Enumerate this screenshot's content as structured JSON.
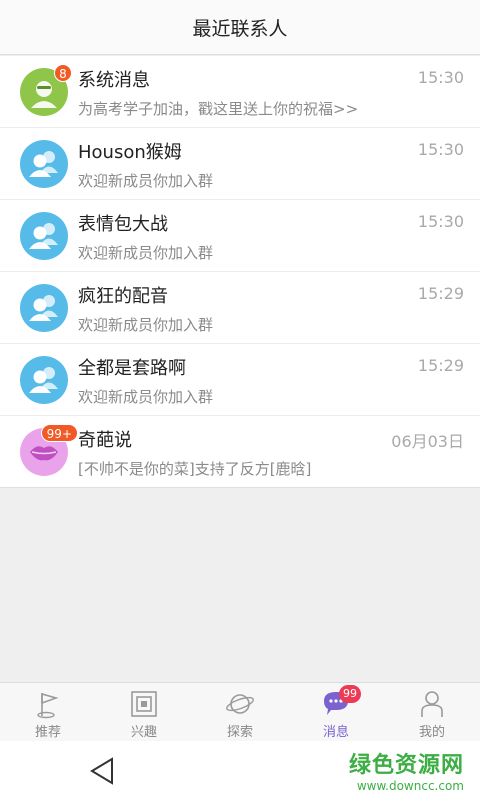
{
  "header": {
    "title": "最近联系人"
  },
  "contacts": [
    {
      "name": "系统消息",
      "time": "15:30",
      "preview": "为高考学子加油，戳这里送上你的祝福>>",
      "badge": "8",
      "avatar": "system"
    },
    {
      "name": "Houson猴姆",
      "time": "15:30",
      "preview": "欢迎新成员你加入群",
      "badge": "",
      "avatar": "group"
    },
    {
      "name": "表情包大战",
      "time": "15:30",
      "preview": "欢迎新成员你加入群",
      "badge": "",
      "avatar": "group"
    },
    {
      "name": "疯狂的配音",
      "time": "15:29",
      "preview": "欢迎新成员你加入群",
      "badge": "",
      "avatar": "group"
    },
    {
      "name": "全都是套路啊",
      "time": "15:29",
      "preview": "欢迎新成员你加入群",
      "badge": "",
      "avatar": "group"
    },
    {
      "name": "奇葩说",
      "time": "06月03日",
      "preview": "[不帅不是你的菜]支持了反方[鹿晗]",
      "badge": "99+",
      "avatar": "lips"
    }
  ],
  "tabs": [
    {
      "label": "推荐",
      "icon": "flag-icon"
    },
    {
      "label": "兴趣",
      "icon": "square-icon"
    },
    {
      "label": "探索",
      "icon": "planet-icon"
    },
    {
      "label": "消息",
      "icon": "chat-bubble-icon",
      "badge": "99",
      "active": true
    },
    {
      "label": "我的",
      "icon": "person-icon"
    }
  ],
  "watermark": {
    "main": "绿色资源网",
    "sub": "www.downcc.com"
  },
  "colors": {
    "accent": "#7a62cf",
    "badge": "#f15a24",
    "group_avatar": "#56bbe8"
  }
}
